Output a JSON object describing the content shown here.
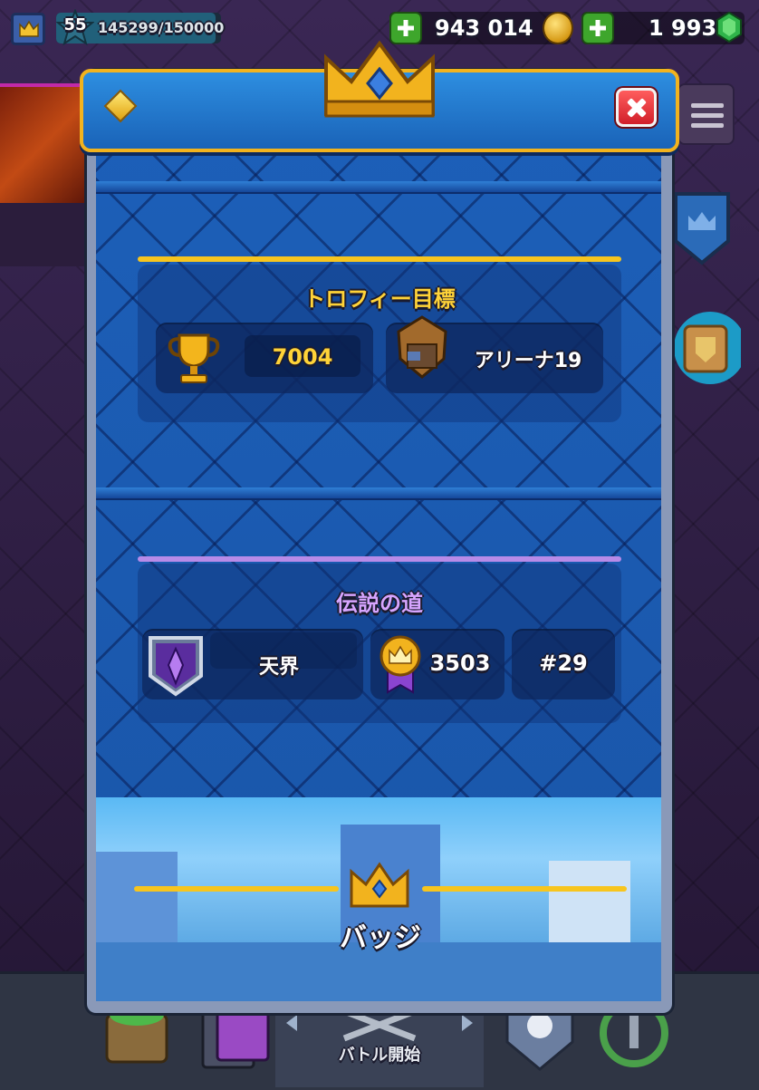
{
  "topbar": {
    "level": "55",
    "xp_text": "145299/150000",
    "xp_progress": 0.9687,
    "gold": "943 014",
    "gems": "1 993"
  },
  "modal": {
    "trophy_section": {
      "title": "トロフィー目標",
      "trophies": "7004",
      "arena": "アリーナ19"
    },
    "legend_section": {
      "title": "伝説の道",
      "league": "天界",
      "rating": "3503",
      "rank": "#29"
    },
    "badges": {
      "title": "バッジ"
    }
  },
  "bottom_nav": {
    "battle_label": "バトル開始"
  },
  "colors": {
    "gold": "#ffd338",
    "purple": "#d7a5ff",
    "modal_blue": "#1c5fb8"
  }
}
